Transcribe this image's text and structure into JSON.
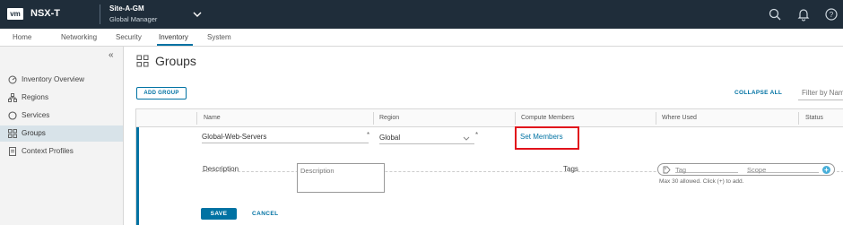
{
  "topbar": {
    "logo": "vm",
    "product": "NSX-T",
    "site": "Site-A-GM",
    "site_role": "Global Manager",
    "icons": [
      "chevron-down-icon",
      "search-icon",
      "bell-icon",
      "help-icon"
    ]
  },
  "nav": {
    "items": [
      "Home",
      "Networking",
      "Security",
      "Inventory",
      "System"
    ],
    "active": "Inventory"
  },
  "sidebar": {
    "items": [
      {
        "label": "Inventory Overview",
        "icon": "gauge-icon"
      },
      {
        "label": "Regions",
        "icon": "hierarchy-icon"
      },
      {
        "label": "Services",
        "icon": "circle-icon"
      },
      {
        "label": "Groups",
        "icon": "groups-icon"
      },
      {
        "label": "Context Profiles",
        "icon": "document-icon"
      }
    ],
    "active": "Groups"
  },
  "page": {
    "title": "Groups",
    "add_group": "ADD GROUP",
    "collapse_all": "COLLAPSE ALL",
    "filter_placeholder": "Filter by Name"
  },
  "grid": {
    "columns": [
      "Name",
      "Region",
      "Compute Members",
      "Where Used",
      "Status"
    ]
  },
  "edit_row": {
    "name_value": "Global-Web-Servers",
    "region_value": "Global",
    "set_members": "Set Members",
    "description_label": "Description",
    "description_placeholder": "Description",
    "tags_label": "Tags",
    "tag_placeholder": "Tag",
    "scope_placeholder": "Scope",
    "tags_hint": "Max 30 allowed. Click (+) to add.",
    "save": "SAVE",
    "cancel": "CANCEL"
  },
  "colors": {
    "topbar": "#1f2d3a",
    "accent": "#0072a3",
    "highlight": "#e1121b",
    "sidebar_active": "#d8e3e9"
  }
}
